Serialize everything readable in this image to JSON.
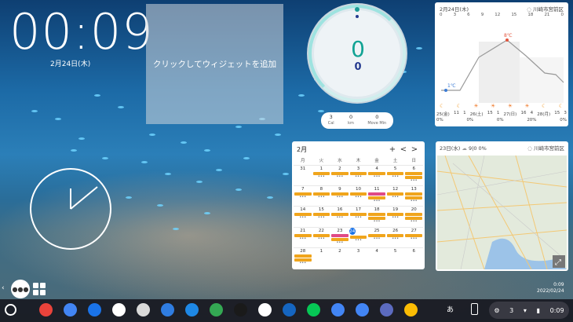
{
  "clock": {
    "time": "00:09",
    "date": "2月24日(木)"
  },
  "add_widget": {
    "label": "クリックしてウィジェットを追加"
  },
  "fit": {
    "main": "0",
    "sub": "0",
    "stats": [
      {
        "value": "3",
        "label": "Cal"
      },
      {
        "value": "0",
        "label": "km"
      },
      {
        "value": "0",
        "label": "Move Min"
      }
    ]
  },
  "weather": {
    "date": "2月24日(木)",
    "location": "川崎市宮前区",
    "hours": [
      "0",
      "3",
      "6",
      "9",
      "12",
      "15",
      "18",
      "21",
      "0"
    ],
    "temps": {
      "low": "1℃",
      "high": "8℃"
    },
    "days": [
      "25(金)",
      "11",
      "1",
      "26(土)",
      "15",
      "1",
      "27(日)",
      "16",
      "4",
      "28(月)",
      "15",
      "3"
    ],
    "precip": [
      "0%",
      "",
      "",
      "0%",
      "",
      "",
      "0%",
      "",
      "20%",
      "",
      "",
      "0%"
    ]
  },
  "calendar": {
    "month": "2月",
    "add": "+",
    "prev": "<",
    "next": ">",
    "dow": [
      "月",
      "火",
      "水",
      "木",
      "金",
      "土",
      "日"
    ],
    "cells": [
      {
        "d": "31",
        "ev": 0
      },
      {
        "d": "1",
        "ev": 1
      },
      {
        "d": "2",
        "ev": 1
      },
      {
        "d": "3",
        "ev": 1
      },
      {
        "d": "4",
        "ev": 1
      },
      {
        "d": "5",
        "ev": 1
      },
      {
        "d": "6",
        "ev": 2
      },
      {
        "d": "7",
        "ev": 1
      },
      {
        "d": "8",
        "ev": 1
      },
      {
        "d": "9",
        "ev": 1
      },
      {
        "d": "10",
        "ev": 1
      },
      {
        "d": "11",
        "ev": 2,
        "pink": 1
      },
      {
        "d": "12",
        "ev": 1
      },
      {
        "d": "13",
        "ev": 2
      },
      {
        "d": "14",
        "ev": 1
      },
      {
        "d": "15",
        "ev": 1
      },
      {
        "d": "16",
        "ev": 1
      },
      {
        "d": "17",
        "ev": 1
      },
      {
        "d": "18",
        "ev": 2
      },
      {
        "d": "19",
        "ev": 1
      },
      {
        "d": "20",
        "ev": 2
      },
      {
        "d": "21",
        "ev": 1
      },
      {
        "d": "22",
        "ev": 1
      },
      {
        "d": "23",
        "ev": 2,
        "pink": 1
      },
      {
        "d": "24",
        "ev": 1,
        "today": 1
      },
      {
        "d": "25",
        "ev": 1
      },
      {
        "d": "26",
        "ev": 1
      },
      {
        "d": "27",
        "ev": 1
      },
      {
        "d": "28",
        "ev": 2
      },
      {
        "d": "1",
        "ev": 0
      },
      {
        "d": "2",
        "ev": 0
      },
      {
        "d": "3",
        "ev": 0
      },
      {
        "d": "4",
        "ev": 0
      },
      {
        "d": "5",
        "ev": 0
      },
      {
        "d": "6",
        "ev": 0
      }
    ]
  },
  "map": {
    "date": "23日(水)",
    "temp": "9|0",
    "pct": "0%",
    "location": "川崎市宮前区"
  },
  "shelf": {
    "ime": "あ",
    "tray": {
      "notifications": "3",
      "time": "0:09"
    },
    "small_time": "0:09",
    "small_date": "2022/02/24",
    "apps": [
      {
        "name": "chrome-icon",
        "color": "#e9433b"
      },
      {
        "name": "google-calendar-icon",
        "color": "#4285f4"
      },
      {
        "name": "tasks-icon",
        "color": "#1a73e8"
      },
      {
        "name": "google-fit-icon",
        "color": "#ffffff"
      },
      {
        "name": "photo-app-icon",
        "color": "#d9d9d9"
      },
      {
        "name": "files-blue-icon",
        "color": "#2f7de1"
      },
      {
        "name": "cloud-icon",
        "color": "#1e88e5"
      },
      {
        "name": "google-maps-icon",
        "color": "#34a853"
      },
      {
        "name": "reading-app-icon",
        "color": "#1a1a1a"
      },
      {
        "name": "fit-heart-icon",
        "color": "#ffffff"
      },
      {
        "name": "files-folder-icon",
        "color": "#1565c0"
      },
      {
        "name": "line-icon",
        "color": "#06c755"
      },
      {
        "name": "google-translate-icon",
        "color": "#4285f4"
      },
      {
        "name": "home-app-icon",
        "color": "#4285f4"
      },
      {
        "name": "tablet-app-icon",
        "color": "#5c6bc0"
      },
      {
        "name": "tote-icon",
        "color": "#fbbc04"
      }
    ]
  }
}
